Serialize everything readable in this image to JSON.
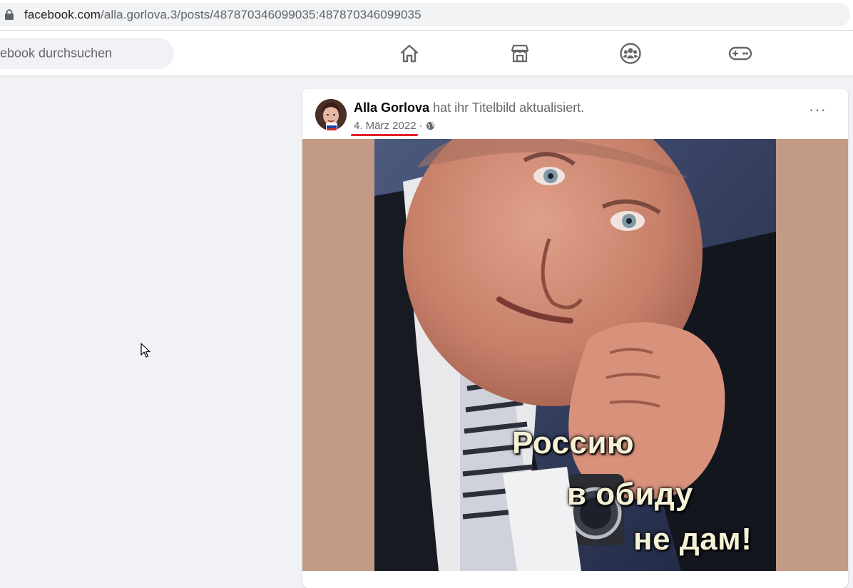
{
  "browser": {
    "url_domain": "facebook.com",
    "url_path": "/alla.gorlova.3/posts/487870346099035:487870346099035"
  },
  "header": {
    "search_placeholder": "ebook durchsuchen",
    "nav_icons": [
      "home-icon",
      "marketplace-icon",
      "groups-icon",
      "gaming-icon"
    ]
  },
  "post": {
    "author": "Alla Gorlova",
    "action": "hat ihr Titelbild aktualisiert.",
    "date": "4. März 2022",
    "separator": "·",
    "visibility_icon": "globe-icon",
    "more_label": "···",
    "photo": {
      "caption_line1": "Россию",
      "caption_line2": "в обиду",
      "caption_line3": "не дам!"
    }
  },
  "colors": {
    "page_bg": "#f0f2f5",
    "photo_frame_bg": "#c29a86",
    "date_underline": "#e0202a",
    "caption_text": "#f4f1d6"
  }
}
